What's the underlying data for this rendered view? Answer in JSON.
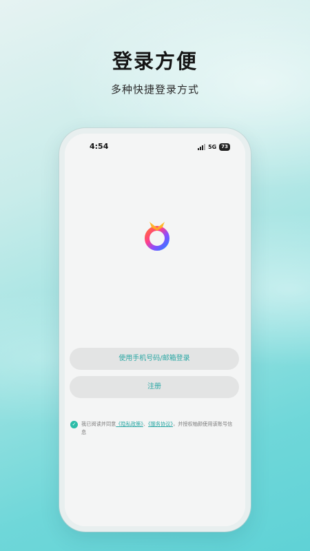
{
  "promo": {
    "title": "登录方便",
    "subtitle": "多种快捷登录方式"
  },
  "status_bar": {
    "time": "4:54",
    "network": "5G",
    "battery": "73"
  },
  "auth": {
    "login_label": "使用手机号码/邮箱登录",
    "register_label": "注册"
  },
  "agreement": {
    "checked": true,
    "prefix": "我已阅读并同意",
    "privacy_link": "《隐私政策》",
    "separator": "、",
    "service_link": "《服务协议》",
    "suffix": "，并授权柚颜使用该账号信息"
  },
  "colors": {
    "accent": "#2aa7a4",
    "check": "#2bbca8",
    "button_bg": "#e3e4e4"
  }
}
